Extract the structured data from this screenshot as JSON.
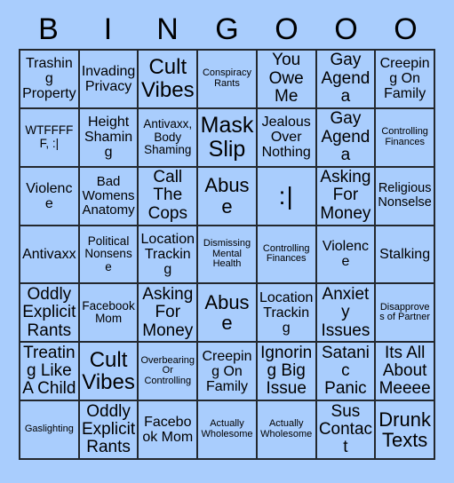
{
  "card": {
    "title": "BINGOOO",
    "background_color": "#a9cdfd",
    "border_color": "#23282e",
    "text_color": "#000000",
    "columns": 7,
    "rows": 7
  },
  "header": {
    "letters": [
      "B",
      "I",
      "N",
      "G",
      "O",
      "O",
      "O"
    ]
  },
  "grid": {
    "rows": [
      [
        {
          "text": "Trashing Property",
          "size": "md"
        },
        {
          "text": "Invading Privacy",
          "size": "md"
        },
        {
          "text": "Cult Vibes",
          "size": "xxl"
        },
        {
          "text": "Conspiracy Rants",
          "size": "xs"
        },
        {
          "text": "You Owe Me",
          "size": "lg"
        },
        {
          "text": "Gay Agenda",
          "size": "lg"
        },
        {
          "text": "Creeping On Family",
          "size": "md"
        }
      ],
      [
        {
          "text": "WTFFFFF, :|",
          "size": "sm"
        },
        {
          "text": "Height Shaming",
          "size": "md"
        },
        {
          "text": "Antivaxx, Body Shaming",
          "size": "sm"
        },
        {
          "text": "Mask Slip",
          "size": "xxl"
        },
        {
          "text": "Jealous Over Nothing",
          "size": "md"
        },
        {
          "text": "Gay Agenda",
          "size": "lg"
        },
        {
          "text": "Controlling Finances",
          "size": "xs"
        }
      ],
      [
        {
          "text": "Violence",
          "size": "md"
        },
        {
          "text": "Bad Womens Anatomy",
          "size": "md"
        },
        {
          "text": "Call The Cops",
          "size": "lg"
        },
        {
          "text": "Abuse",
          "size": "xl"
        },
        {
          "text": ":|",
          "size": "emoji"
        },
        {
          "text": "Asking For Money",
          "size": "lg"
        },
        {
          "text": "Religious Nonselse",
          "size": "md"
        }
      ],
      [
        {
          "text": "Antivaxx",
          "size": "md"
        },
        {
          "text": "Political Nonsense",
          "size": "sm"
        },
        {
          "text": "Location Tracking",
          "size": "md"
        },
        {
          "text": "Dismissing Mental Health",
          "size": "xs"
        },
        {
          "text": "Controlling Finances",
          "size": "xs"
        },
        {
          "text": "Violence",
          "size": "md"
        },
        {
          "text": "Stalking",
          "size": "md"
        }
      ],
      [
        {
          "text": "Oddly Explicit Rants",
          "size": "lg"
        },
        {
          "text": "Facebook Mom",
          "size": "sm"
        },
        {
          "text": "Asking For Money",
          "size": "lg"
        },
        {
          "text": "Abuse",
          "size": "xl"
        },
        {
          "text": "Location Tracking",
          "size": "md"
        },
        {
          "text": "Anxiety Issues",
          "size": "lg"
        },
        {
          "text": "Disapproves of Partner",
          "size": "xs"
        }
      ],
      [
        {
          "text": "Treating Like A Child",
          "size": "lg"
        },
        {
          "text": "Cult Vibes",
          "size": "xxl"
        },
        {
          "text": "Overbearing Or Controlling",
          "size": "xs"
        },
        {
          "text": "Creeping On Family",
          "size": "md"
        },
        {
          "text": "Ignoring Big Issue",
          "size": "lg"
        },
        {
          "text": "Satanic Panic",
          "size": "lg"
        },
        {
          "text": "Its All About Meeee",
          "size": "lg"
        }
      ],
      [
        {
          "text": "Gaslighting",
          "size": "xs"
        },
        {
          "text": "Oddly Explicit Rants",
          "size": "lg"
        },
        {
          "text": "Facebook Mom",
          "size": "md"
        },
        {
          "text": "Actually Wholesome",
          "size": "xs"
        },
        {
          "text": "Actually Wholesome",
          "size": "xs"
        },
        {
          "text": "Sus Contact",
          "size": "lg"
        },
        {
          "text": "Drunk Texts",
          "size": "xl"
        }
      ]
    ]
  }
}
